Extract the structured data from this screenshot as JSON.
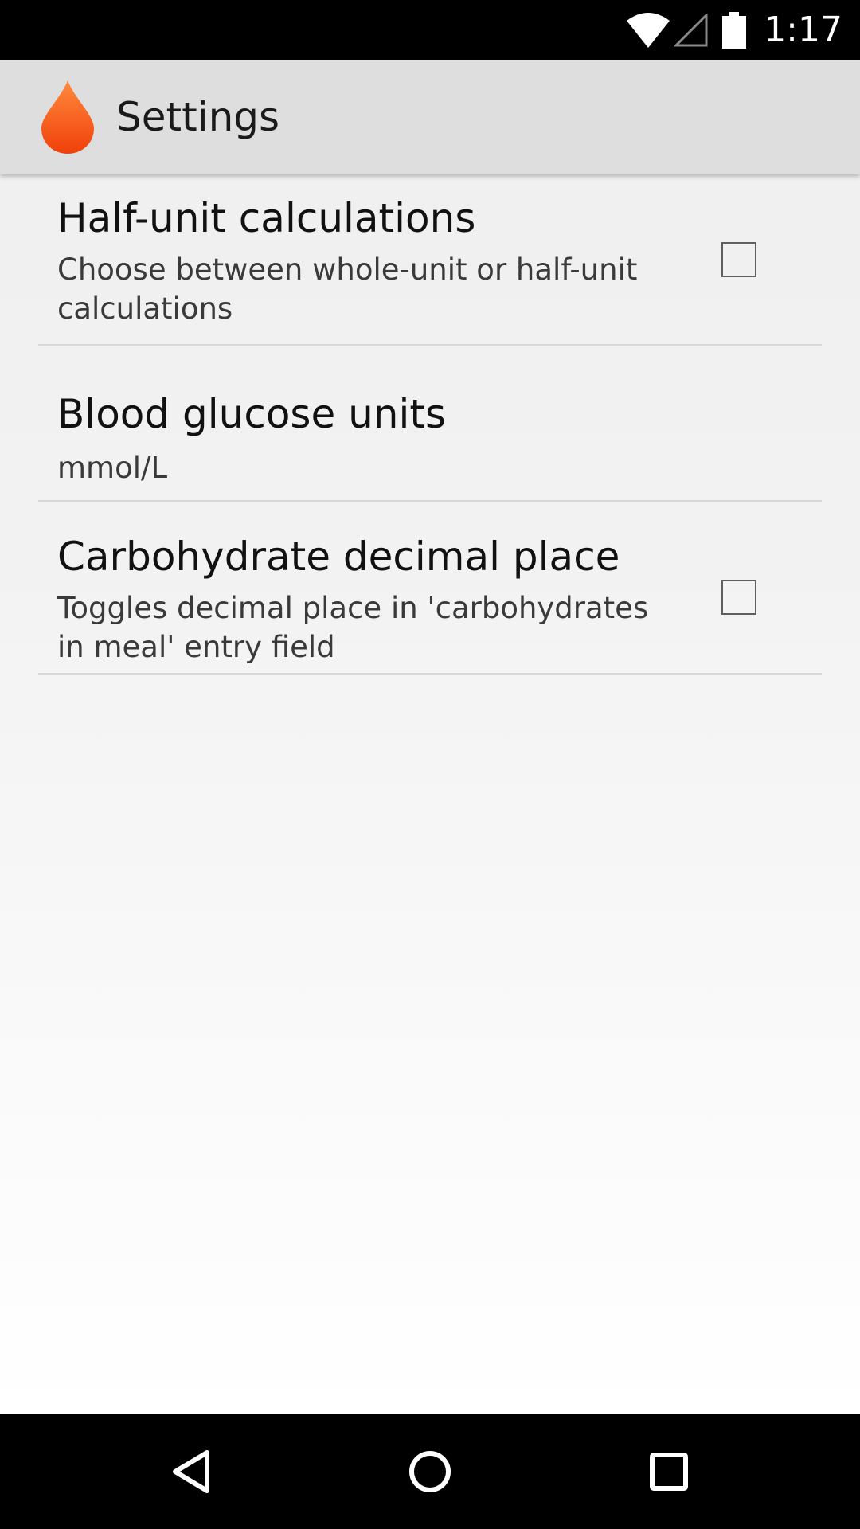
{
  "status_bar": {
    "time": "1:17",
    "icons": [
      "wifi-icon",
      "cell-signal-icon",
      "battery-icon"
    ]
  },
  "app_bar": {
    "title": "Settings",
    "icon": "blood-drop-icon",
    "accent_color": "#ff5a1f"
  },
  "preferences": [
    {
      "title": "Half-unit calculations",
      "summary": "Choose between whole-unit or half-unit calculations",
      "type": "checkbox",
      "checked": false
    },
    {
      "title": "Blood glucose units",
      "summary": "mmol/L",
      "type": "list"
    },
    {
      "title": "Carbohydrate decimal place",
      "summary": "Toggles decimal place in 'carbohydrates in meal' entry field",
      "type": "checkbox",
      "checked": false
    }
  ],
  "nav_bar": {
    "icons": [
      "back-icon",
      "home-icon",
      "recents-icon"
    ]
  }
}
